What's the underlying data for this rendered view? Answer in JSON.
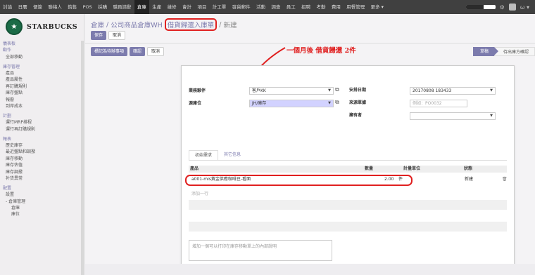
{
  "topnav": {
    "items": [
      "討論",
      "日曆",
      "便簽",
      "聯絡人",
      "銷售",
      "POS",
      "採購",
      "職員請辭",
      "倉庫",
      "生產",
      "維修",
      "會計",
      "項目",
      "計工單",
      "發貨郵件",
      "活動",
      "調查",
      "員工",
      "招聘",
      "考勤",
      "費用",
      "用餐管理",
      "更多 ▾"
    ],
    "active_index": 8,
    "progress_fraction": 0.6,
    "user_initial": "ω ▾"
  },
  "sidebar": {
    "logo_text": "STARBUCKS",
    "logo_mark": "★",
    "items": [
      {
        "type": "sec",
        "label": "儀表板"
      },
      {
        "type": "sec",
        "label": "動作"
      },
      {
        "type": "item",
        "label": "全部移動"
      },
      {
        "type": "gap"
      },
      {
        "type": "sec",
        "label": "庫存管理"
      },
      {
        "type": "item",
        "label": "產品"
      },
      {
        "type": "item",
        "label": "產品屬性"
      },
      {
        "type": "item",
        "label": "再訂購規則"
      },
      {
        "type": "item",
        "label": "庫存盤點"
      },
      {
        "type": "item",
        "label": "報廢"
      },
      {
        "type": "item",
        "label": "到岸成本"
      },
      {
        "type": "gap"
      },
      {
        "type": "sec",
        "label": "計劃"
      },
      {
        "type": "item",
        "label": "運行MRP排程"
      },
      {
        "type": "item",
        "label": "運行再訂購規則"
      },
      {
        "type": "gap"
      },
      {
        "type": "sec",
        "label": "報表"
      },
      {
        "type": "item",
        "label": "歷史庫存"
      },
      {
        "type": "item",
        "label": "最近盤點和調撥"
      },
      {
        "type": "item",
        "label": "庫存移動"
      },
      {
        "type": "item",
        "label": "庫存估值"
      },
      {
        "type": "item",
        "label": "庫存調撥"
      },
      {
        "type": "item",
        "label": "补货異常"
      },
      {
        "type": "gap"
      },
      {
        "type": "sec",
        "label": "配置"
      },
      {
        "type": "item",
        "label": "設置"
      },
      {
        "type": "item",
        "label": "- 倉庫管理"
      },
      {
        "type": "sub",
        "label": "倉庫"
      },
      {
        "type": "sub",
        "label": "庫位"
      }
    ]
  },
  "breadcrumb": {
    "root": "倉庫",
    "sep1": "/",
    "mid": "公司商品倉庫WH",
    "highlighted": "借貨歸還入庫單",
    "sep2": "/",
    "current": "新建"
  },
  "actions": {
    "save": "保存",
    "discard": "取消"
  },
  "workflow": {
    "mark_todo": "標記為待辦事項",
    "confirm": "確認",
    "cancel": "取消"
  },
  "statusbar": {
    "active": "草稿",
    "next": "待出庫方確認"
  },
  "annotation": "一個月後 借貨歸還 2件",
  "form": {
    "partner_label": "業務夥伴",
    "partner_value": "客戶KK",
    "dest_label": "源庫位",
    "dest_value": "JH/庫存",
    "schedule_label": "安排日期",
    "schedule_value": "20170808 183433",
    "origin_label": "來源單據",
    "origin_placeholder": "例如：PO0032",
    "owner_label": "擁有者",
    "owner_value": ""
  },
  "tabs": [
    "初始需求",
    "其它信息"
  ],
  "table": {
    "headers": [
      "產品",
      "數量",
      "計量單位",
      "狀態"
    ],
    "rows": [
      {
        "product": "a001-mis黃金供應咖啡豆-看面",
        "qty": "2.00",
        "uom": "件",
        "status": "新建"
      }
    ],
    "add_line": "添加一行"
  },
  "note_placeholder": "增加一個可以打印在庫存移動單上的內部說明"
}
